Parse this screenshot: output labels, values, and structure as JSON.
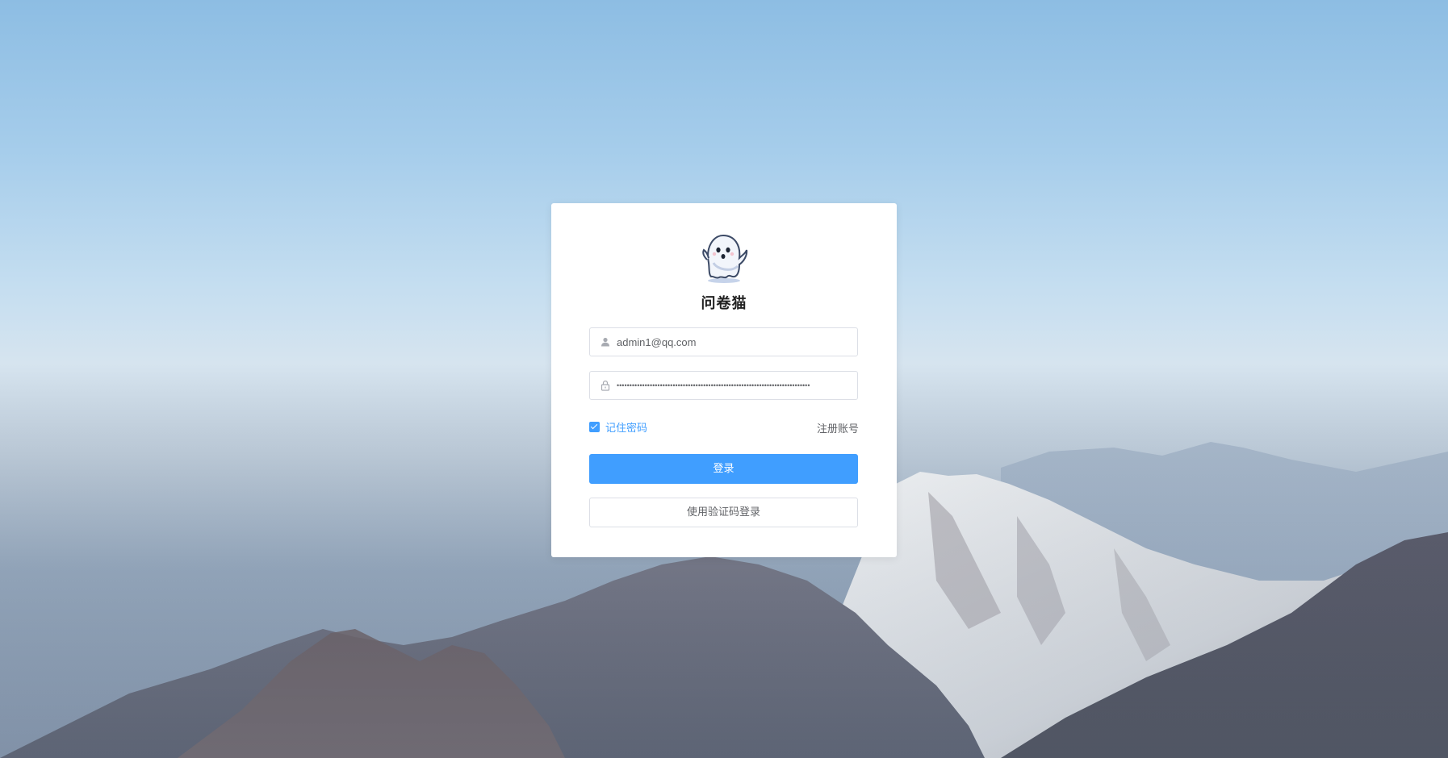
{
  "app": {
    "title": "问卷猫",
    "logo_icon": "ghost-mascot-icon"
  },
  "login_form": {
    "username": {
      "value": "admin1@qq.com",
      "icon": "user-icon"
    },
    "password": {
      "value": "••••••••••••••••••••••••••••••••••••••••••••••••••••••••••••••••••••••••••••",
      "icon": "lock-icon"
    },
    "remember": {
      "label": "记住密码",
      "checked": true
    },
    "register_label": "注册账号",
    "login_button_label": "登录",
    "code_login_button_label": "使用验证码登录"
  },
  "colors": {
    "primary": "#409eff",
    "card_bg": "#ffffff",
    "text": "#606266",
    "border": "#dcdfe6"
  }
}
